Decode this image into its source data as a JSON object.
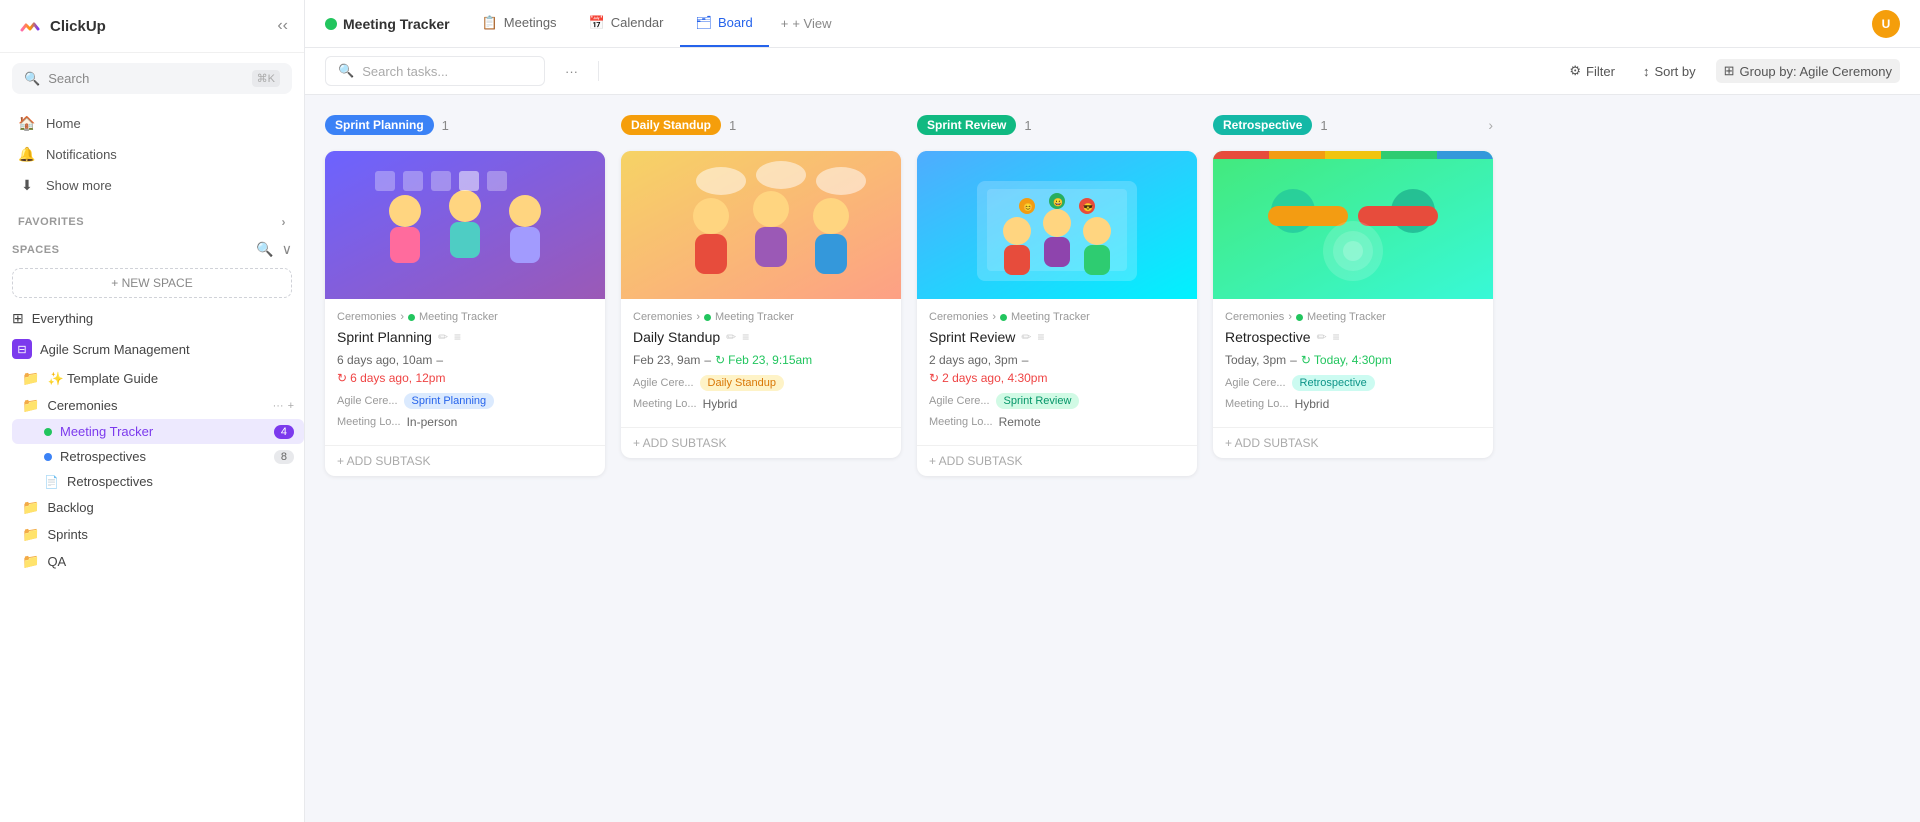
{
  "app": {
    "name": "ClickUp"
  },
  "sidebar": {
    "search": {
      "placeholder": "Search",
      "shortcut": "⌘K"
    },
    "nav": [
      {
        "id": "home",
        "label": "Home",
        "icon": "🏠"
      },
      {
        "id": "notifications",
        "label": "Notifications",
        "icon": "🔔"
      },
      {
        "id": "show-more",
        "label": "Show more",
        "icon": "⬇"
      }
    ],
    "favorites_label": "FAVORITES",
    "spaces_label": "SPACES",
    "new_space_label": "+ NEW SPACE",
    "spaces": [
      {
        "id": "everything",
        "label": "Everything",
        "type": "all"
      },
      {
        "id": "agile-scrum",
        "label": "Agile Scrum Management",
        "type": "space",
        "color": "purple"
      }
    ],
    "folders": [
      {
        "id": "template-guide",
        "label": "✨ Template Guide",
        "color": "blue"
      },
      {
        "id": "ceremonies",
        "label": "Ceremonies",
        "color": "blue",
        "actions": [
          "...",
          "+"
        ],
        "lists": [
          {
            "id": "meeting-tracker",
            "label": "Meeting Tracker",
            "dot": "green",
            "count": "4",
            "active": true
          },
          {
            "id": "retrospectives",
            "label": "Retrospectives",
            "dot": "blue",
            "count": "8"
          }
        ],
        "docs": [
          {
            "id": "retrospectives-doc",
            "label": "Retrospectives"
          }
        ]
      },
      {
        "id": "backlog",
        "label": "Backlog",
        "color": "green"
      },
      {
        "id": "sprints",
        "label": "Sprints",
        "color": "green"
      },
      {
        "id": "qa",
        "label": "QA",
        "color": "green"
      }
    ]
  },
  "top_nav": {
    "page_title": "Meeting Tracker",
    "tabs": [
      {
        "id": "meetings",
        "label": "Meetings",
        "icon": "📋"
      },
      {
        "id": "calendar",
        "label": "Calendar",
        "icon": "📅"
      },
      {
        "id": "board",
        "label": "Board",
        "icon": "🗂",
        "active": true
      }
    ],
    "add_view_label": "+ View"
  },
  "toolbar": {
    "search_placeholder": "Search tasks...",
    "more_icon": "···",
    "filter_label": "Filter",
    "sort_label": "Sort by",
    "group_label": "Group by: Agile Ceremony"
  },
  "board": {
    "columns": [
      {
        "id": "sprint-planning",
        "tag": "Sprint Planning",
        "tag_class": "sprint-planning",
        "count": 1,
        "cards": [
          {
            "id": "sp-1",
            "img_type": "sprint-planning",
            "breadcrumb": [
              "Ceremonies",
              "Meeting Tracker"
            ],
            "title": "Sprint Planning",
            "date_start": "6 days ago, 10am",
            "date_end": "–",
            "overdue_date": "6 days ago, 12pm",
            "overdue": true,
            "tags": [
              {
                "label": "Agile Cere...",
                "pill_label": "Sprint Planning",
                "pill_class": "tag-sprint-planning"
              }
            ],
            "meta_label": "Meeting Lo...",
            "meta_value": "In-person",
            "add_subtask": "+ ADD SUBTASK"
          }
        ]
      },
      {
        "id": "daily-standup",
        "tag": "Daily Standup",
        "tag_class": "daily-standup",
        "count": 1,
        "cards": [
          {
            "id": "ds-1",
            "img_type": "daily-standup",
            "breadcrumb": [
              "Ceremonies",
              "Meeting Tracker"
            ],
            "title": "Daily Standup",
            "date_start": "Feb 23, 9am",
            "date_end": "–",
            "ok_date": "Feb 23, 9:15am",
            "overdue": false,
            "tags": [
              {
                "label": "Agile Cere...",
                "pill_label": "Daily Standup",
                "pill_class": "tag-daily-standup"
              }
            ],
            "meta_label": "Meeting Lo...",
            "meta_value": "Hybrid",
            "add_subtask": "+ ADD SUBTASK"
          }
        ]
      },
      {
        "id": "sprint-review",
        "tag": "Sprint Review",
        "tag_class": "sprint-review",
        "count": 1,
        "cards": [
          {
            "id": "sr-1",
            "img_type": "sprint-review",
            "breadcrumb": [
              "Ceremonies",
              "Meeting Tracker"
            ],
            "title": "Sprint Review",
            "date_start": "2 days ago, 3pm",
            "date_end": "–",
            "overdue_date": "2 days ago, 4:30pm",
            "overdue": true,
            "tags": [
              {
                "label": "Agile Cere...",
                "pill_label": "Sprint Review",
                "pill_class": "tag-sprint-review"
              }
            ],
            "meta_label": "Meeting Lo...",
            "meta_value": "Remote",
            "add_subtask": "+ ADD SUBTASK"
          }
        ]
      },
      {
        "id": "retrospective",
        "tag": "Retrospective",
        "tag_class": "retrospective",
        "count": 1,
        "cards": [
          {
            "id": "ret-1",
            "img_type": "retrospective",
            "breadcrumb": [
              "Ceremonies",
              "Meeting Tracker"
            ],
            "title": "Retrospective",
            "date_start": "Today, 3pm",
            "date_end": "–",
            "ok_date": "Today, 4:30pm",
            "overdue": false,
            "tags": [
              {
                "label": "Agile Cere...",
                "pill_label": "Retrospective",
                "pill_class": "tag-retrospective"
              }
            ],
            "meta_label": "Meeting Lo...",
            "meta_value": "Hybrid",
            "add_subtask": "+ ADD SUBTASK"
          }
        ]
      }
    ]
  }
}
